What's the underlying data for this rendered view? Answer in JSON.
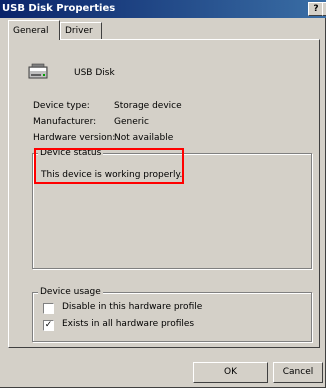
{
  "window": {
    "title": "USB Disk Properties",
    "help_label": "?",
    "close_label": "×"
  },
  "tabs": [
    {
      "label": "General",
      "active": true
    },
    {
      "label": "Driver",
      "active": false
    }
  ],
  "device": {
    "name": "USB Disk",
    "icon": "usb-disk-icon"
  },
  "properties": [
    {
      "label": "Device type:",
      "value": "Storage device"
    },
    {
      "label": "Manufacturer:",
      "value": "Generic"
    },
    {
      "label": "Hardware version:",
      "value": "Not available"
    }
  ],
  "device_status": {
    "title": "Device status",
    "text": "This device is working properly."
  },
  "device_usage": {
    "title": "Device usage",
    "options": [
      {
        "label": "Disable in this hardware profile",
        "checked": false
      },
      {
        "label": "Exists in all hardware profiles",
        "checked": true
      }
    ]
  },
  "buttons": {
    "ok": "OK",
    "cancel": "Cancel"
  },
  "colors": {
    "highlight": "#ff0000",
    "titlebar": "#0a246a"
  }
}
